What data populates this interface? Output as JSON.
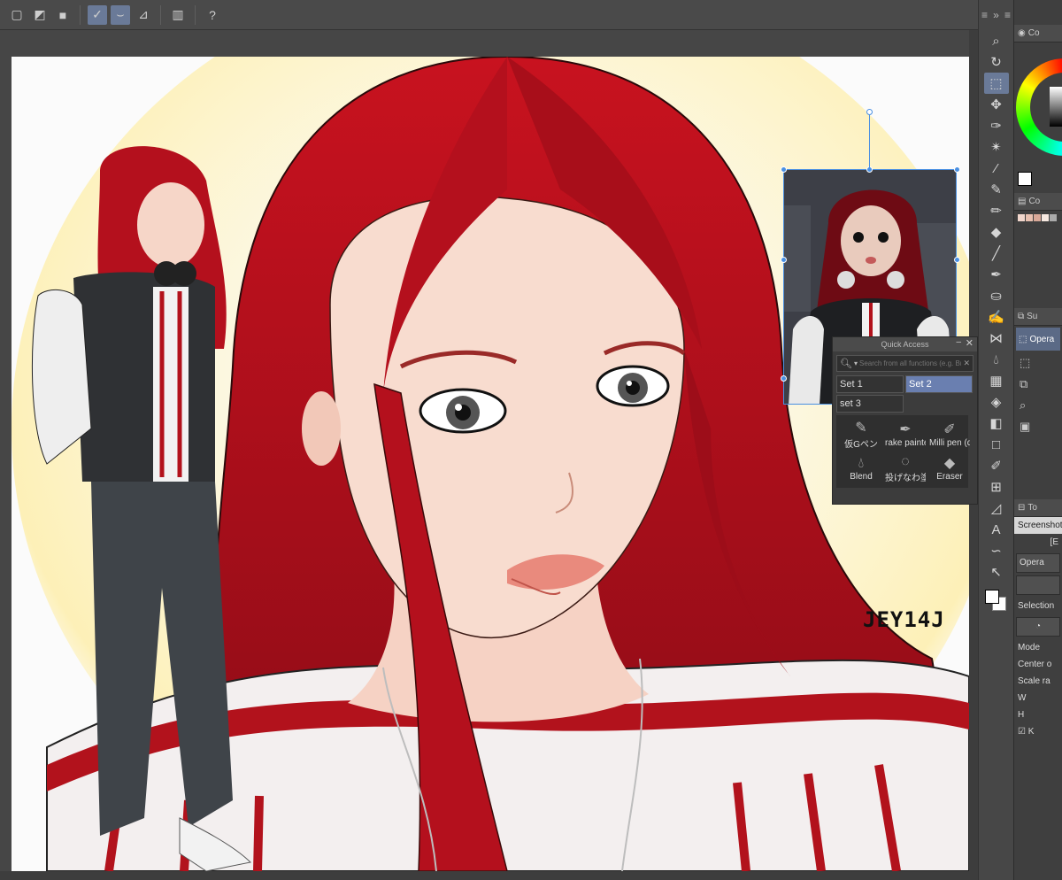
{
  "toolbar": {
    "buttons": [
      "square-outline-icon",
      "gradient-square-icon",
      "square-filled-icon",
      "check-line-icon",
      "curve-check-icon",
      "ruler-corner-icon",
      "device-icon",
      "help-icon"
    ]
  },
  "canvas": {
    "signature": "JEY14J"
  },
  "quick_access": {
    "title": "Quick Access",
    "search_placeholder": "Search from all functions (e.g. Br",
    "sets": [
      {
        "label": "Set 1",
        "active": false
      },
      {
        "label": "Set 2",
        "active": true
      },
      {
        "label": "set 3",
        "active": false
      }
    ],
    "tools": [
      {
        "label": "仮Gペン",
        "icon": "pen-icon"
      },
      {
        "label": "rake painter",
        "icon": "nib-icon"
      },
      {
        "label": "Milli pen (du",
        "icon": "marker-icon"
      },
      {
        "label": "Blend",
        "icon": "blend-drop-icon"
      },
      {
        "label": "投げなわ塗",
        "icon": "lasso-fill-icon"
      },
      {
        "label": "Eraser",
        "icon": "eraser-icon"
      }
    ]
  },
  "right_panel": {
    "color_tab": "Co",
    "color_set_tab": "Co",
    "layer_tab": "Su",
    "layer_operation": "Opera",
    "tool_property_tab": "To",
    "tool_name": "Screenshot",
    "sub_label": "[E",
    "operation_btn": "Opera",
    "selection_label": "Selection",
    "mode_label": "Mode",
    "center_label": "Center o",
    "scale_label": "Scale ra",
    "w_label": "W",
    "h_label": "H",
    "keep_label": "K"
  },
  "colors": {
    "accent": "#6a7a98",
    "selection": "#4a90e2",
    "hair": "#b30f1c"
  }
}
